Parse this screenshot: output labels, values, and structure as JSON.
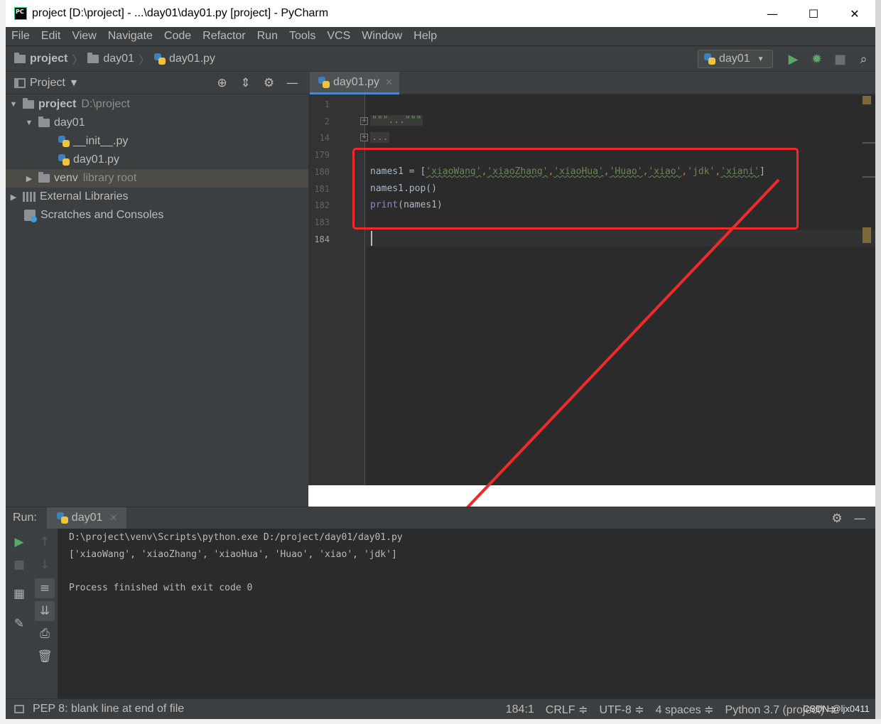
{
  "window": {
    "title": "project [D:\\project] - ...\\day01\\day01.py [project] - PyCharm",
    "logo_text": "PC",
    "minimize": "—",
    "maximize": "☐",
    "close": "✕"
  },
  "menu": [
    {
      "label": "File"
    },
    {
      "label": "Edit"
    },
    {
      "label": "View"
    },
    {
      "label": "Navigate"
    },
    {
      "label": "Code"
    },
    {
      "label": "Refactor"
    },
    {
      "label": "Run"
    },
    {
      "label": "Tools"
    },
    {
      "label": "VCS"
    },
    {
      "label": "Window"
    },
    {
      "label": "Help"
    }
  ],
  "breadcrumb": {
    "root": "project",
    "folder": "day01",
    "file": "day01.py"
  },
  "run_config": {
    "name": "day01"
  },
  "project_panel": {
    "title": "Project",
    "tree": {
      "root_name": "project",
      "root_path": "D:\\project",
      "day01": "day01",
      "init_file": "__init__.py",
      "main_file": "day01.py",
      "venv": "venv",
      "venv_note": "library root",
      "ext_libs": "External Libraries",
      "scratches": "Scratches and Consoles"
    }
  },
  "editor": {
    "tab_label": "day01.py",
    "line_numbers": [
      "1",
      "2",
      "14",
      "179",
      "180",
      "181",
      "182",
      "183",
      "184"
    ],
    "folded_doc": "\"\"\"...\"\"\"",
    "folded_imports": "...",
    "code": {
      "var": "names1",
      "assign": " = ",
      "open_bracket": "[",
      "items": [
        "'xiaoWang'",
        "'xiaoZhang'",
        "'xiaoHua'",
        "'Huao'",
        "'xiao'",
        "'jdk'",
        "'xiani'"
      ],
      "close_bracket": "]",
      "line181": "names1.pop()",
      "print_kw": "print",
      "print_args": "(names1)"
    }
  },
  "run_panel": {
    "label": "Run:",
    "tab": "day01",
    "console": {
      "command": "D:\\project\\venv\\Scripts\\python.exe D:/project/day01/day01.py",
      "output": "['xiaoWang', 'xiaoZhang', 'xiaoHua', 'Huao', 'xiao', 'jdk']",
      "exit": "Process finished with exit code 0"
    }
  },
  "status_bar": {
    "message": "PEP 8: blank line at end of file",
    "position": "184:1",
    "line_sep": "CRLF ≑",
    "encoding": "UTF-8 ≑",
    "indent": "4 spaces ≑",
    "interpreter": "Python 3.7 (project) ≑"
  },
  "watermark": "CSDN @ljx0411",
  "colors": {
    "annotation": "#f02a2a",
    "run_green": "#59a869",
    "string_green": "#6a8759"
  }
}
